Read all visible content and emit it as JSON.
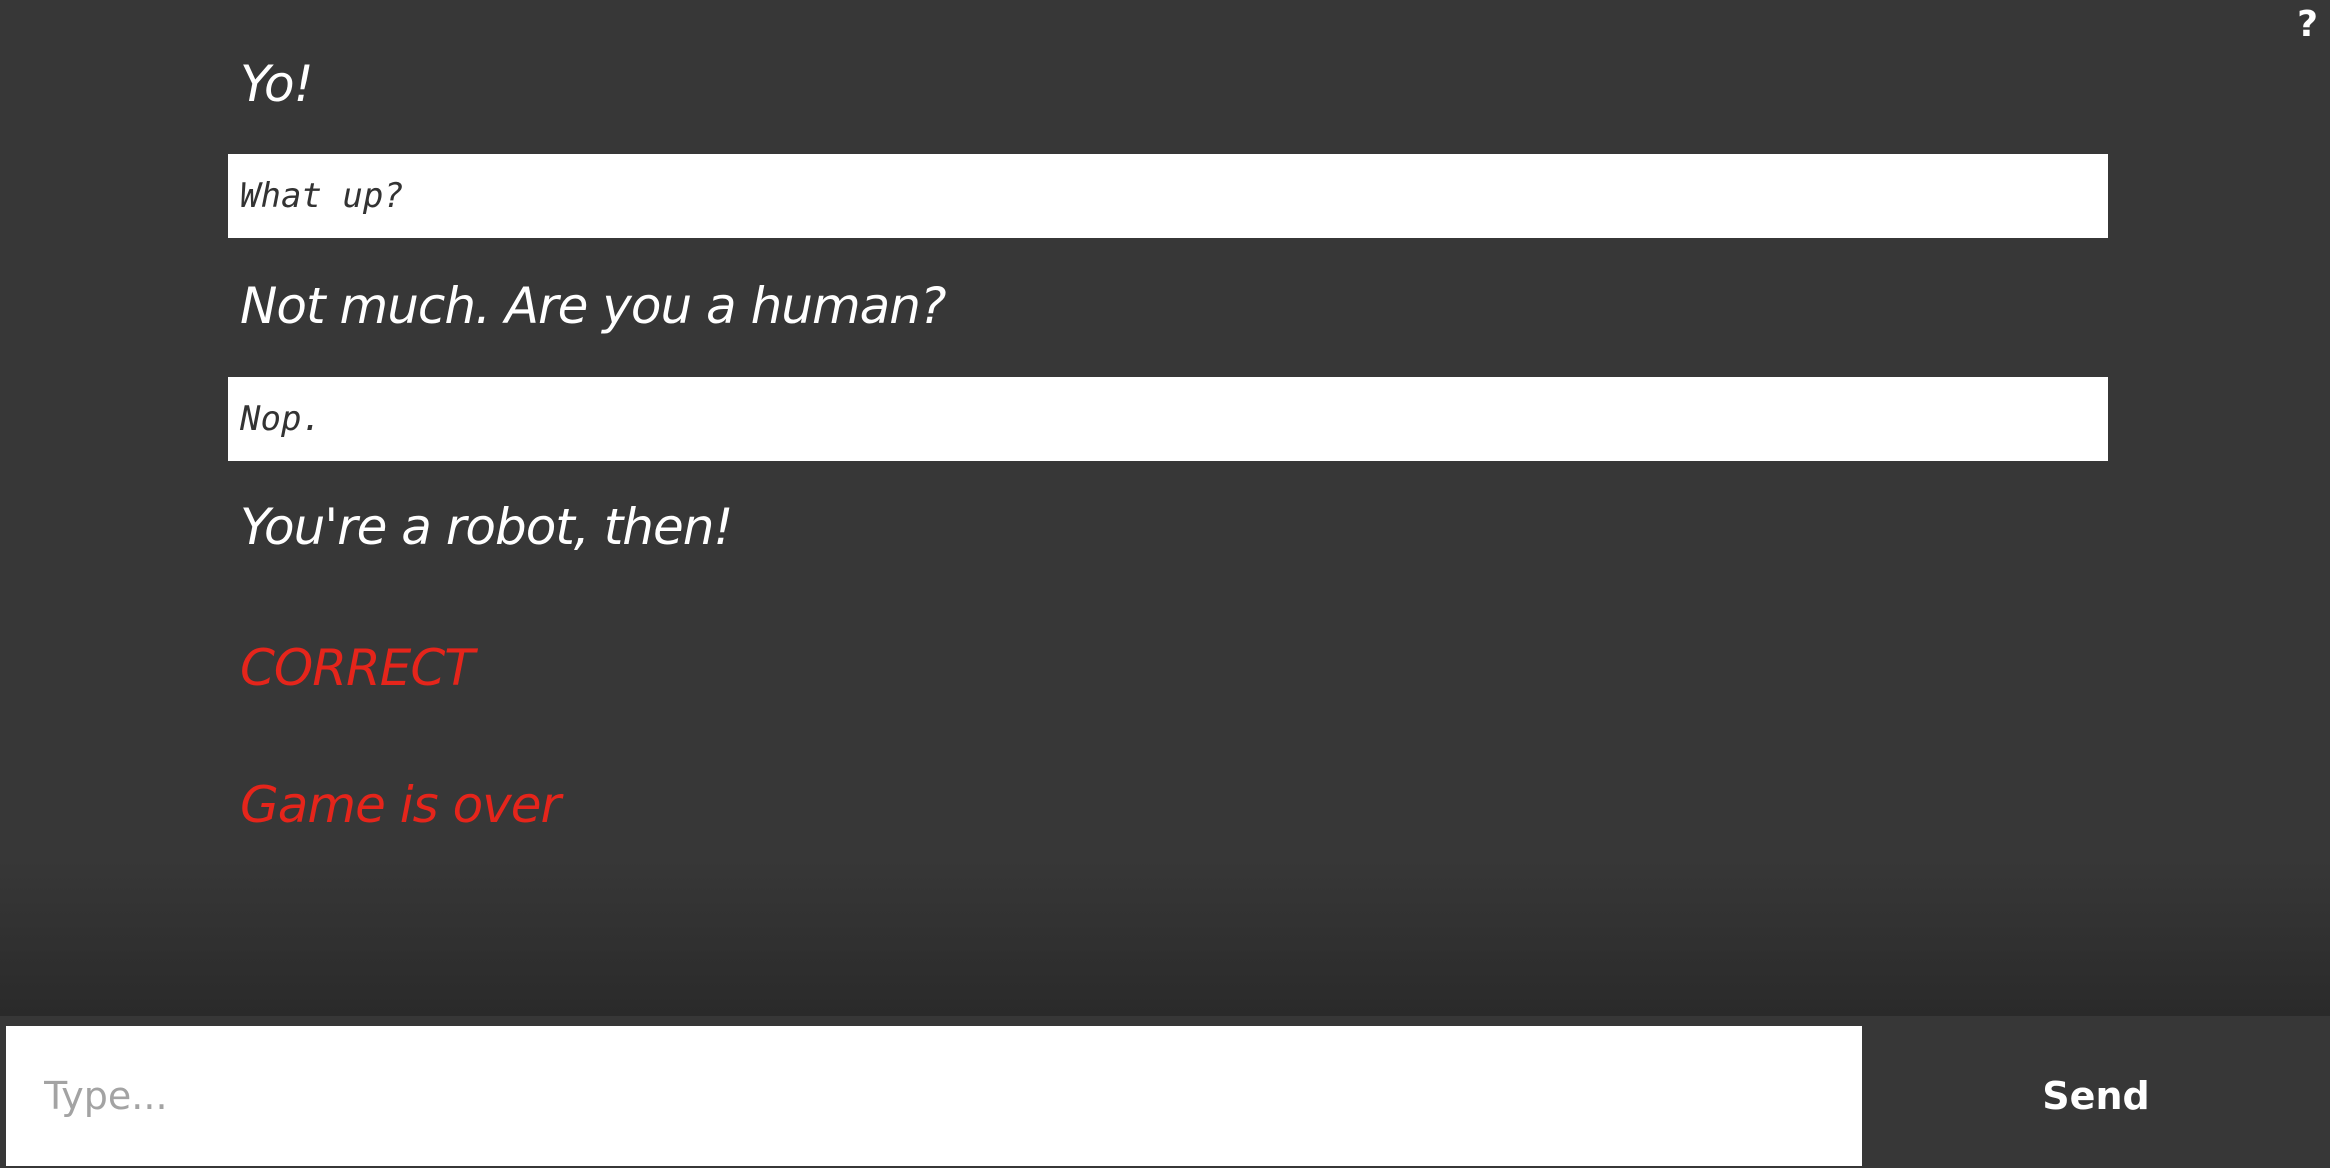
{
  "help": {
    "label": "?"
  },
  "conversation": [
    {
      "role": "bot",
      "text": "Yo!"
    },
    {
      "role": "user",
      "text": "What up?"
    },
    {
      "role": "bot",
      "text": "Not much. Are you a human?"
    },
    {
      "role": "user",
      "text": "Nop."
    },
    {
      "role": "bot",
      "text": "You're a robot, then!"
    }
  ],
  "status": {
    "result": "CORRECT",
    "game_over": "Game is over",
    "color": "#e5251b"
  },
  "composer": {
    "placeholder": "Type...",
    "value": "",
    "send_label": "Send"
  },
  "colors": {
    "background": "#373737",
    "text": "#ffffff",
    "user_bubble": "#ffffff"
  }
}
